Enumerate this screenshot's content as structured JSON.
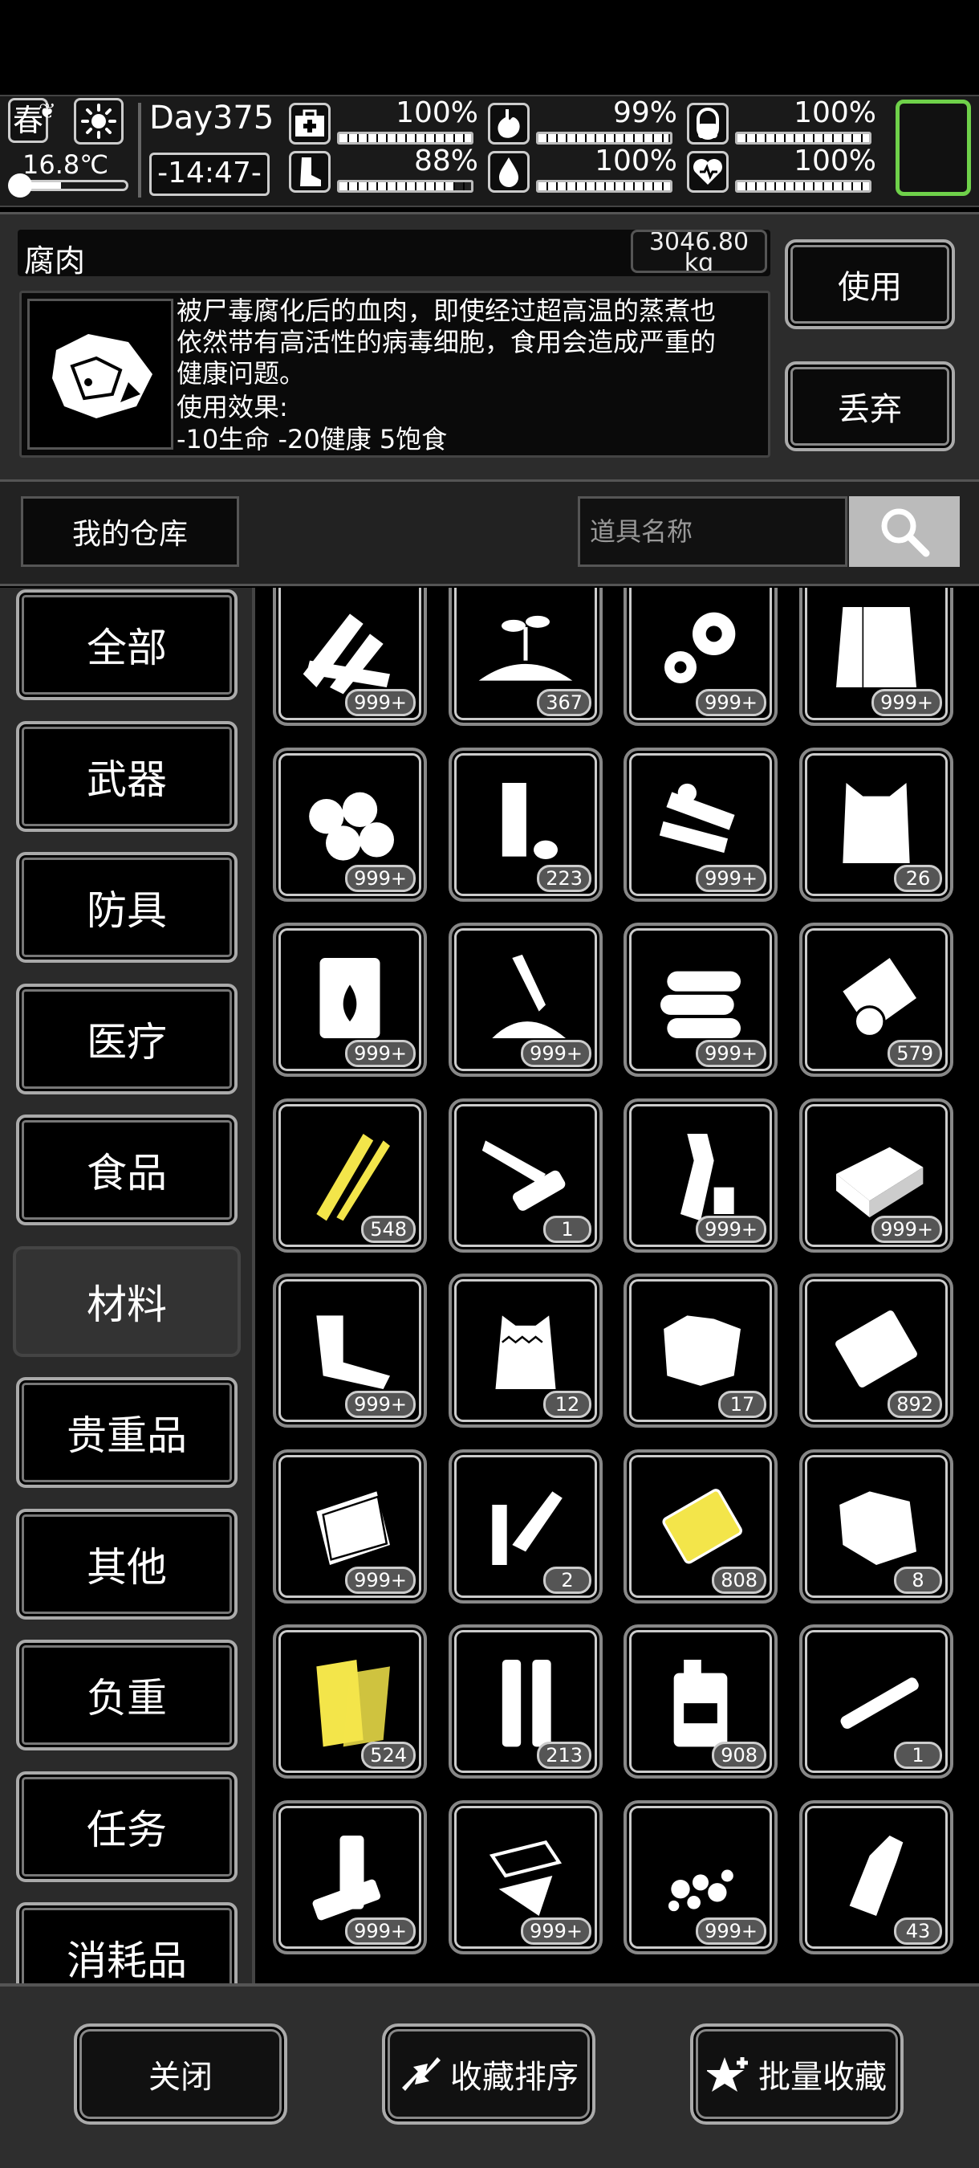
{
  "hud": {
    "season": "春",
    "temperature": "16.8℃",
    "day": "Day375",
    "time": "-14:47-",
    "stats": [
      {
        "name": "health",
        "icon": "medkit-icon",
        "percent": "100%",
        "value": 1.0
      },
      {
        "name": "hunger",
        "icon": "stomach-icon",
        "percent": "99%",
        "value": 0.99
      },
      {
        "name": "immunity",
        "icon": "pill-icon",
        "percent": "100%",
        "value": 1.0
      },
      {
        "name": "stamina",
        "icon": "boot-icon",
        "percent": "88%",
        "value": 0.88
      },
      {
        "name": "thirst",
        "icon": "water-drop-icon",
        "percent": "100%",
        "value": 1.0
      },
      {
        "name": "mood",
        "icon": "heart-icon",
        "percent": "100%",
        "value": 1.0
      }
    ]
  },
  "item": {
    "name": "腐肉",
    "weight": "3046.80 kg",
    "description": "被尸毒腐化后的血肉，即使经过超高温的蒸煮也\n依然带有高活性的病毒细胞，食用会造成严重的\n健康问题。",
    "effect_label": "使用效果:",
    "effect_value": "-10生命 -20健康 5饱食",
    "use_label": "使用",
    "drop_label": "丢弃"
  },
  "warehouse": {
    "tab_label": "我的仓库",
    "search_placeholder": "道具名称"
  },
  "categories": [
    "全部",
    "武器",
    "防具",
    "医疗",
    "食品",
    "材料",
    "贵重品",
    "其他",
    "负重",
    "任务",
    "消耗品"
  ],
  "active_category": "材料",
  "items": [
    {
      "icon": "wood-planks-icon",
      "count": "999+"
    },
    {
      "icon": "seedling-soil-icon",
      "count": "367"
    },
    {
      "icon": "gears-icon",
      "count": "999+"
    },
    {
      "icon": "cloth-icon",
      "count": "999+"
    },
    {
      "icon": "cotton-balls-icon",
      "count": "999+"
    },
    {
      "icon": "tube-and-cap-icon",
      "count": "223"
    },
    {
      "icon": "machine-parts-icon",
      "count": "999+"
    },
    {
      "icon": "fur-sack-icon",
      "count": "26"
    },
    {
      "icon": "fuel-barrel-icon",
      "count": "999+"
    },
    {
      "icon": "glue-pile-icon",
      "count": "999+"
    },
    {
      "icon": "logs-icon",
      "count": "999+"
    },
    {
      "icon": "paper-roll-icon",
      "count": "579"
    },
    {
      "icon": "yellow-sticks-icon",
      "count": "548"
    },
    {
      "icon": "pocket-knife-icon",
      "count": "1"
    },
    {
      "icon": "plastic-bottles-icon",
      "count": "999+"
    },
    {
      "icon": "brick-icon",
      "count": "999+"
    },
    {
      "icon": "scrap-metal-icon",
      "count": "999+"
    },
    {
      "icon": "wool-sack-icon",
      "count": "12"
    },
    {
      "icon": "animal-hide-icon",
      "count": "17"
    },
    {
      "icon": "metal-plate-icon",
      "count": "892"
    },
    {
      "icon": "glass-sheet-icon",
      "count": "999+"
    },
    {
      "icon": "spark-plug-icon",
      "count": "2"
    },
    {
      "icon": "gold-plate-icon",
      "count": "808"
    },
    {
      "icon": "leather-scrap-icon",
      "count": "8"
    },
    {
      "icon": "yellow-boards-icon",
      "count": "524"
    },
    {
      "icon": "pipes-icon",
      "count": "213"
    },
    {
      "icon": "jerrycan-icon",
      "count": "908"
    },
    {
      "icon": "rod-icon",
      "count": "1"
    },
    {
      "icon": "batteries-icon",
      "count": "999+"
    },
    {
      "icon": "glass-shards-icon",
      "count": "999+"
    },
    {
      "icon": "gravel-icon",
      "count": "999+"
    },
    {
      "icon": "glass-bottle-icon",
      "count": "43"
    }
  ],
  "footer": {
    "close_label": "关闭",
    "sort_label": "收藏排序",
    "batch_label": "批量收藏"
  },
  "colors": {
    "background": "#000000",
    "panel": "#2c2c2c",
    "slot_border": "#6fd14a",
    "highlight_yellow": "#f3e54a"
  }
}
